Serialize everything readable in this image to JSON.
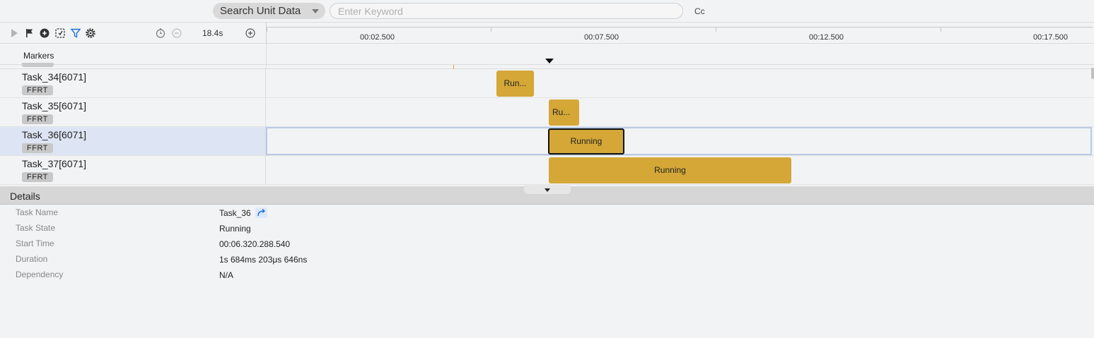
{
  "search": {
    "scope_label": "Search Unit Data",
    "placeholder": "Enter Keyword",
    "value": "",
    "case_toggle": "Cc"
  },
  "toolbar": {
    "icons": [
      "play-icon",
      "flag-icon",
      "add-circle-icon",
      "select-region-icon",
      "filter-icon",
      "settings-icon",
      "zoom-reset-icon",
      "zoom-out-icon",
      "zoom-in-icon"
    ],
    "zoom_level": "18.4s"
  },
  "ruler": {
    "ticks": [
      "00:02.500",
      "00:07.500",
      "00:12.500",
      "00:17.500"
    ]
  },
  "markers": {
    "label": "Markers"
  },
  "tasks": [
    {
      "name": "Task_34[6071]",
      "badge": "FFRT",
      "bar_label": "Run...",
      "selected": false
    },
    {
      "name": "Task_35[6071]",
      "badge": "FFRT",
      "bar_label": "Ru...",
      "selected": false
    },
    {
      "name": "Task_36[6071]",
      "badge": "FFRT",
      "bar_label": "Running",
      "selected": true
    },
    {
      "name": "Task_37[6071]",
      "badge": "FFRT",
      "bar_label": "Running",
      "selected": false
    }
  ],
  "details": {
    "title": "Details",
    "fields": [
      {
        "label": "Task Name",
        "value": "Task_36"
      },
      {
        "label": "Task State",
        "value": "Running"
      },
      {
        "label": "Start Time",
        "value": "00:06.320.288.540"
      },
      {
        "label": "Duration",
        "value": "1s 684ms 203μs 646ns"
      },
      {
        "label": "Dependency",
        "value": "N/A"
      }
    ]
  },
  "colors": {
    "bar": "#d4a737",
    "selection": "#dde5f4",
    "accent": "#1e6fe0"
  }
}
